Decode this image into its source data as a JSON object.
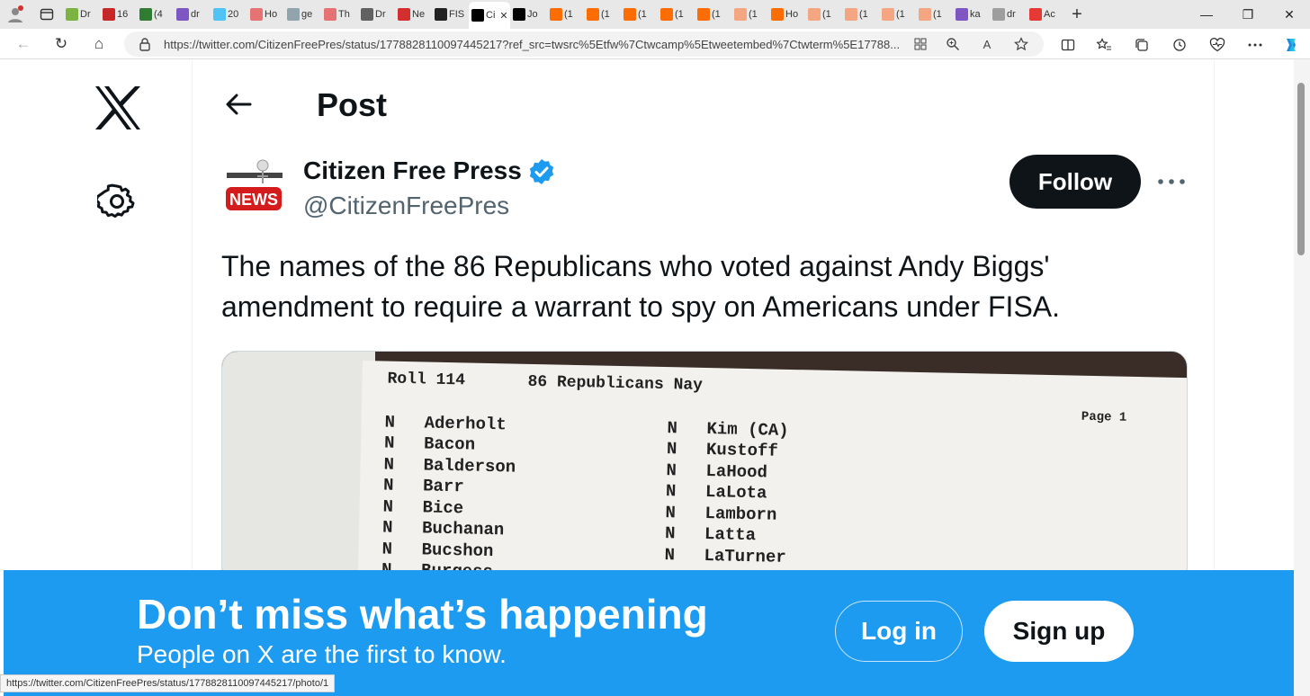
{
  "browser": {
    "tabs": [
      {
        "label": "Dr",
        "color": "#7cb342"
      },
      {
        "label": "16",
        "color": "#c62828"
      },
      {
        "label": "(4",
        "color": "#2e7d32"
      },
      {
        "label": "dr",
        "color": "#7e57c2"
      },
      {
        "label": "20",
        "color": "#4fc3f7"
      },
      {
        "label": "Ho",
        "color": "#e57373"
      },
      {
        "label": "ge",
        "color": "#90a4ae"
      },
      {
        "label": "Th",
        "color": "#e57373"
      },
      {
        "label": "Dr",
        "color": "#616161"
      },
      {
        "label": "Ne",
        "color": "#d32f2f"
      },
      {
        "label": "FIS",
        "color": "#212121"
      },
      {
        "label": "Ci",
        "color": "#000000",
        "active": true,
        "close": "✕"
      },
      {
        "label": "Jo",
        "color": "#000000"
      },
      {
        "label": "(1",
        "color": "#ff6d00"
      },
      {
        "label": "(1",
        "color": "#ff6d00"
      },
      {
        "label": "(1",
        "color": "#ff6d00"
      },
      {
        "label": "(1",
        "color": "#ff6d00"
      },
      {
        "label": "(1",
        "color": "#ff6d00"
      },
      {
        "label": "(1",
        "color": "#f4a582"
      },
      {
        "label": "Ho",
        "color": "#ff6d00"
      },
      {
        "label": "(1",
        "color": "#f4a582"
      },
      {
        "label": "(1",
        "color": "#f4a582"
      },
      {
        "label": "(1",
        "color": "#f4a582"
      },
      {
        "label": "(1",
        "color": "#f4a582"
      },
      {
        "label": "ka",
        "color": "#7e57c2"
      },
      {
        "label": "dr",
        "color": "#9e9e9e"
      },
      {
        "label": "Ac",
        "color": "#e53935"
      }
    ],
    "new_tab": "+",
    "window_controls": {
      "minimize": "—",
      "restore": "❐",
      "close": "✕"
    },
    "url": "https://twitter.com/CitizenFreePres/status/1778828110097445217?ref_src=twsrc%5Etfw%7Ctwcamp%5Etweetembed%7Ctwterm%5E17788...",
    "nav": {
      "back": "←",
      "reload": "↻",
      "home": "⌂"
    },
    "status_url": "https://twitter.com/CitizenFreePres/status/1778828110097445217/photo/1"
  },
  "page": {
    "heading": "Post",
    "author": {
      "name": "Citizen Free Press",
      "handle": "@CitizenFreePres"
    },
    "follow_label": "Follow",
    "tweet_text": "The names of the 86 Republicans who voted against Andy Biggs' amendment to require a warrant to spy on Americans under FISA.",
    "media": {
      "header_left": "Roll 114",
      "header_right": "86 Republicans Nay",
      "page_label": "Page 1",
      "col1": [
        {
          "vote": "N",
          "name": "Aderholt"
        },
        {
          "vote": "N",
          "name": "Bacon"
        },
        {
          "vote": "N",
          "name": "Balderson"
        },
        {
          "vote": "N",
          "name": "Barr"
        },
        {
          "vote": "N",
          "name": "Bice"
        },
        {
          "vote": "N",
          "name": "Buchanan"
        },
        {
          "vote": "N",
          "name": "Bucshon"
        },
        {
          "vote": "N",
          "name": "Burgess"
        }
      ],
      "col2": [
        {
          "vote": "N",
          "name": "Kim (CA)"
        },
        {
          "vote": "N",
          "name": "Kustoff"
        },
        {
          "vote": "N",
          "name": "LaHood"
        },
        {
          "vote": "N",
          "name": "LaLota"
        },
        {
          "vote": "N",
          "name": "Lamborn"
        },
        {
          "vote": "N",
          "name": "Latta"
        },
        {
          "vote": "N",
          "name": "LaTurner"
        }
      ]
    }
  },
  "banner": {
    "title": "Don’t miss what’s happening",
    "subtitle": "People on X are the first to know.",
    "login_label": "Log in",
    "signup_label": "Sign up"
  },
  "colors": {
    "accent": "#1d9bf0",
    "text": "#0f1419",
    "muted": "#536471"
  }
}
